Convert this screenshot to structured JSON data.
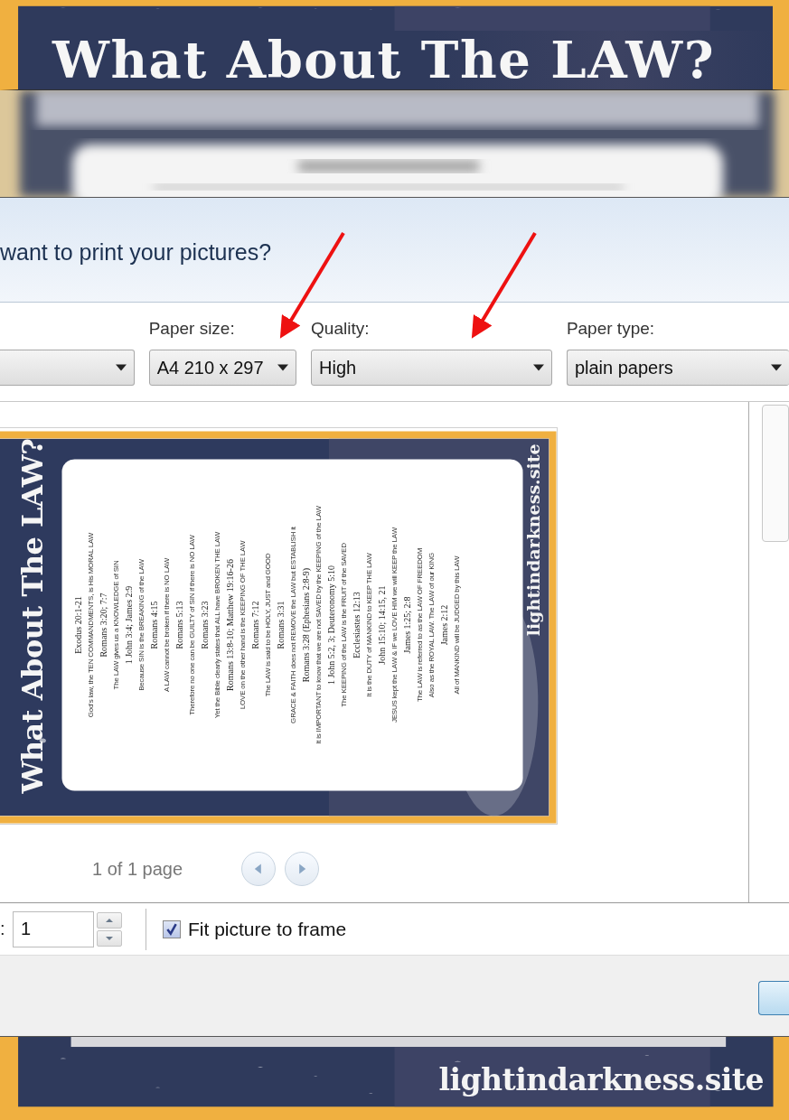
{
  "background_poster": {
    "title": "What About The LAW?",
    "site": "lightindarkness.site"
  },
  "dialog": {
    "heading": "want to print your pictures?",
    "dropdowns": [
      {
        "label": "Paper size:",
        "value": "A4 210 x 297"
      },
      {
        "label": "Quality:",
        "value": "High"
      },
      {
        "label": "Paper type:",
        "value": "plain papers"
      }
    ],
    "preview": {
      "poster": {
        "title": "What About The LAW?",
        "site": "lightindarkness.site",
        "lines": [
          {
            "kind": "ref",
            "text": "Exodus 20:1-21"
          },
          {
            "kind": "note",
            "text": "God's law, the TEN COMMANDMENTS, is His MORAL LAW"
          },
          {
            "kind": "ref",
            "text": "Romans 3:20; 7:7"
          },
          {
            "kind": "note",
            "text": "The LAW gives us a KNOWLEDGE of SIN"
          },
          {
            "kind": "ref",
            "text": "1 John 3:4; James 2:9"
          },
          {
            "kind": "note",
            "text": "Because SIN is the BREAKING of the LAW"
          },
          {
            "kind": "ref",
            "text": "Romans 4:15"
          },
          {
            "kind": "note",
            "text": "A LAW cannot be broken if there is NO LAW"
          },
          {
            "kind": "ref",
            "text": "Romans 5:13"
          },
          {
            "kind": "note",
            "text": "Therefore no one can be GUILTY of SIN if there is NO LAW"
          },
          {
            "kind": "ref",
            "text": "Romans 3:23"
          },
          {
            "kind": "note",
            "text": "Yet the Bible clearly states that ALL have BROKEN THE LAW"
          },
          {
            "kind": "ref",
            "text": "Romans 13:8-10; Matthew 19:16-26"
          },
          {
            "kind": "note",
            "text": "LOVE on the other hand is the KEEPING OF THE LAW"
          },
          {
            "kind": "ref",
            "text": "Romans 7:12"
          },
          {
            "kind": "note",
            "text": "The LAW is said to be HOLY, JUST and GOOD"
          },
          {
            "kind": "ref",
            "text": "Romans 3:31"
          },
          {
            "kind": "note",
            "text": "GRACE & FAITH does not REMOVE the LAW but ESTABLISH it"
          },
          {
            "kind": "ref",
            "text": "Romans 3:28 (Ephesians 2:8-9)"
          },
          {
            "kind": "note",
            "text": "It is IMPORTANT to know that we are not SAVED by the KEEPING of the LAW"
          },
          {
            "kind": "ref",
            "text": "1 John 5:2, 3; Deuteronomy 5:10"
          },
          {
            "kind": "note",
            "text": "The KEEPING of the LAW is the FRUIT of the SAVED"
          },
          {
            "kind": "ref",
            "text": "Ecclesiastes 12:13"
          },
          {
            "kind": "note",
            "text": "It is the DUTY of MANKIND to KEEP THE LAW"
          },
          {
            "kind": "ref",
            "text": "John 15:10; 14:15, 21"
          },
          {
            "kind": "note",
            "text": "JESUS kept the LAW & IF we LOVE HIM we will KEEP the LAW"
          },
          {
            "kind": "ref",
            "text": "James 1:25; 2:8"
          },
          {
            "kind": "note",
            "text": "The LAW is referred to as the LAW OF FREEDOM"
          },
          {
            "kind": "note",
            "text": "Also as the ROYAL LAW. The LAW of our KING"
          },
          {
            "kind": "ref",
            "text": "James 2:12"
          },
          {
            "kind": "note",
            "text": "All of MANKIND will be JUDGED by this LAW"
          }
        ]
      },
      "page_count": "1 of 1 page"
    },
    "copies": {
      "label_end": ":",
      "value": "1"
    },
    "fit_to_frame": {
      "label": "Fit picture to frame",
      "checked": true
    }
  }
}
